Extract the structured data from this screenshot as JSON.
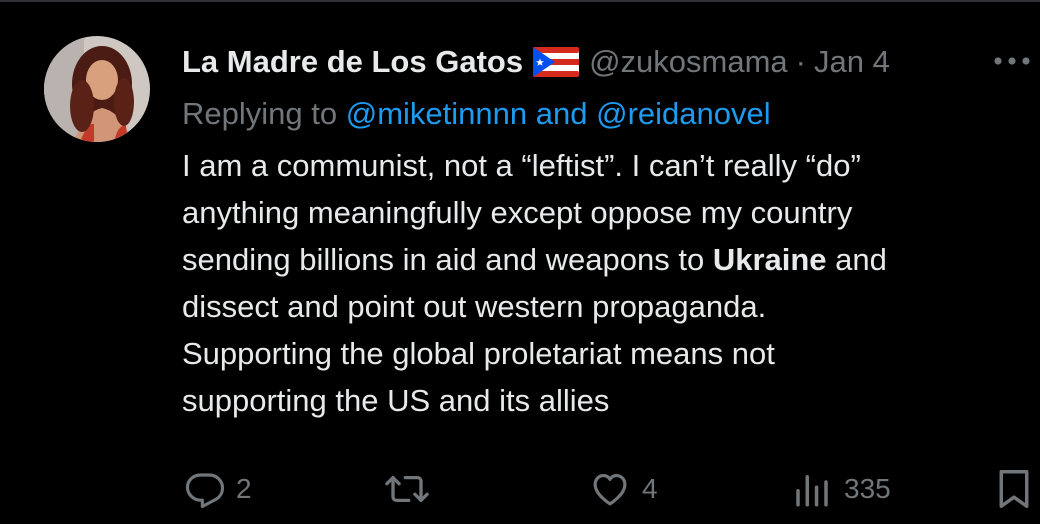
{
  "author": {
    "display_name": "La Madre de Los Gatos",
    "handle": "@zukosmama",
    "separator": "·",
    "date": "Jan 4",
    "flag_icon": "puerto-rico-flag-icon"
  },
  "reply": {
    "prefix": "Replying to",
    "mention_1": "@miketinnnn",
    "conjunction": "and",
    "mention_2": "@reidanovel"
  },
  "tweet": {
    "line1": "I am a communist, not a “leftist”. I can’t really “do”",
    "line2": "anything meaningfully except oppose my country",
    "line3_before": "sending billions in aid and weapons to ",
    "line3_bold": "Ukraine",
    "line3_after": " and",
    "line4": "dissect and point out western propaganda.",
    "line5": "Supporting the global proletariat means not",
    "line6": "supporting the US and its allies"
  },
  "actions": {
    "replies": "2",
    "reposts": "",
    "likes": "4",
    "views": "335"
  },
  "colors": {
    "background": "#000000",
    "text_primary": "#e7e9ea",
    "text_secondary": "#71767b",
    "link": "#1d9bf0"
  }
}
